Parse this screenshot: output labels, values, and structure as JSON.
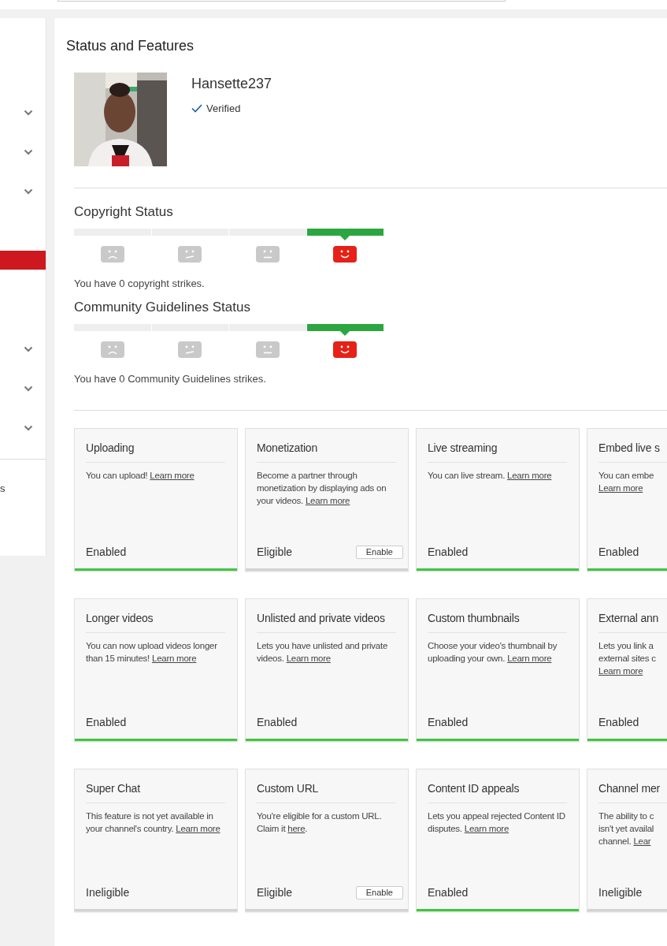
{
  "sidebar": {
    "groups": [
      {
        "items": [
          {
            "kind": "expandable",
            "expanded": false
          },
          {
            "kind": "expandable",
            "expanded": false
          },
          {
            "kind": "expandable",
            "expanded": false
          }
        ]
      },
      {
        "items": [
          {
            "kind": "bar",
            "selected": true
          }
        ]
      },
      {
        "items": [
          {
            "kind": "expandable",
            "expanded": false
          },
          {
            "kind": "expandable",
            "expanded": false
          },
          {
            "kind": "expandable",
            "expanded": false
          }
        ]
      }
    ],
    "footer_text": "s"
  },
  "page_title": "Status and Features",
  "profile": {
    "name": "Hansette237",
    "verified": true,
    "verified_label": "Verified"
  },
  "statuses": [
    {
      "title": "Copyright Status",
      "segments": [
        {
          "kind": "sad",
          "selected": false
        },
        {
          "kind": "unsure",
          "selected": false
        },
        {
          "kind": "neutral",
          "selected": false
        },
        {
          "kind": "happy",
          "selected": true
        }
      ],
      "message": "You have 0 copyright strikes."
    },
    {
      "title": "Community Guidelines Status",
      "segments": [
        {
          "kind": "sad",
          "selected": false
        },
        {
          "kind": "unsure",
          "selected": false
        },
        {
          "kind": "neutral",
          "selected": false
        },
        {
          "kind": "happy",
          "selected": true
        }
      ],
      "message": "You have 0 Community Guidelines strikes."
    }
  ],
  "features": [
    {
      "title": "Uploading",
      "desc": "You can upload! ",
      "link": "Learn more",
      "status": "Enabled",
      "enabled": true
    },
    {
      "title": "Monetization",
      "desc": "Become a partner through monetization by displaying ads on your videos. ",
      "link": "Learn more",
      "status": "Eligible",
      "enabled": false,
      "button": "Enable"
    },
    {
      "title": "Live streaming",
      "desc": "You can live stream. ",
      "link": "Learn more",
      "status": "Enabled",
      "enabled": true
    },
    {
      "title": "Embed live s",
      "desc_lines": [
        "You can embe"
      ],
      "link": "Learn more",
      "status": "Enabled",
      "enabled": true
    },
    {
      "title": "Longer videos",
      "desc": "You can now upload videos longer than 15 minutes! ",
      "link": "Learn more",
      "status": "Enabled",
      "enabled": true
    },
    {
      "title": "Unlisted and private videos",
      "desc": "Lets you have unlisted and private videos. ",
      "link": "Learn more",
      "status": "Enabled",
      "enabled": true
    },
    {
      "title": "Custom thumbnails",
      "desc": "Choose your video's thumbnail by uploading your own. ",
      "link": "Learn more",
      "status": "Enabled",
      "enabled": true
    },
    {
      "title": "External ann",
      "desc_lines": [
        "Lets you link a",
        "external sites c"
      ],
      "link": "Learn more",
      "status": "Enabled",
      "enabled": true
    },
    {
      "title": "Super Chat",
      "desc": "This feature is not yet available in your channel's country. ",
      "link": "Learn more",
      "status": "Ineligible",
      "enabled": false
    },
    {
      "title": "Custom URL",
      "desc": "You're eligible for a custom URL. Claim it ",
      "link": "here",
      "desc_after": ".",
      "status": "Eligible",
      "enabled": false,
      "button": "Enable"
    },
    {
      "title": "Content ID appeals",
      "desc": "Lets you appeal rejected Content ID disputes. ",
      "link": "Learn more",
      "status": "Enabled",
      "enabled": true
    },
    {
      "title": "Channel mer",
      "desc_lines": [
        "The ability to c",
        "isn't yet availal",
        "channel. "
      ],
      "link": "Lear",
      "status": "Ineligible",
      "enabled": false
    }
  ]
}
